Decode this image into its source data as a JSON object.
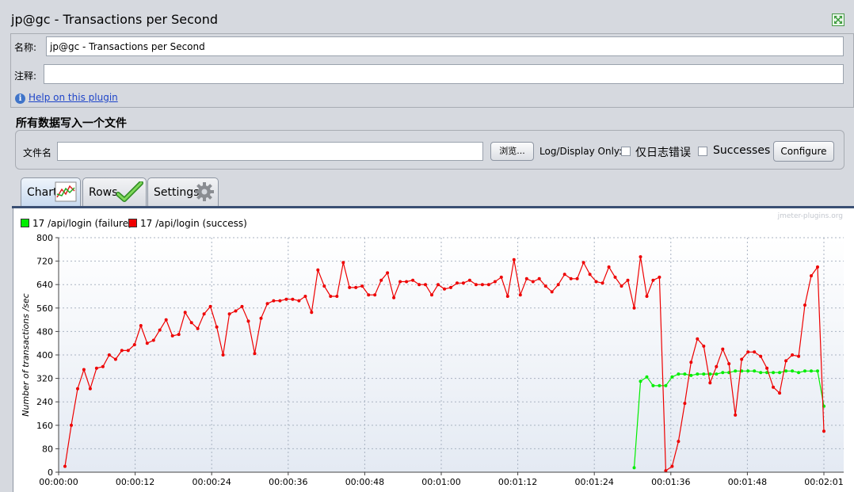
{
  "window": {
    "title": "jp@gc - Transactions per Second"
  },
  "form": {
    "name_label": "名称:",
    "name_value": "jp@gc - Transactions per Second",
    "comment_label": "注释:",
    "comment_value": "",
    "help_link": "Help on this plugin"
  },
  "file_section": {
    "title": "所有数据写入一个文件",
    "filename_label": "文件名",
    "filename_value": "",
    "browse_label": "浏览...",
    "log_display_label": "Log/Display Only:",
    "errors_only_label": "仅日志错误",
    "errors_only_checked": false,
    "successes_label": "Successes",
    "successes_checked": false,
    "configure_label": "Configure"
  },
  "tabs": [
    {
      "label": "Chart",
      "icon": "chart-icon",
      "active": true
    },
    {
      "label": "Rows",
      "icon": "checkmark-icon",
      "active": false
    },
    {
      "label": "Settings",
      "icon": "gear-icon",
      "active": false
    }
  ],
  "watermark": "jmeter-plugins.org",
  "colors": {
    "failure": "#00ee00",
    "success": "#ee0000",
    "tab_rule": "#3a4f73",
    "link": "#1f45c9"
  },
  "chart_data": {
    "type": "line",
    "ylabel": "Number of transactions /sec",
    "xlabel": "",
    "ylim": [
      0,
      800
    ],
    "yticks": [
      0,
      80,
      160,
      240,
      320,
      400,
      480,
      560,
      640,
      720,
      800
    ],
    "xticks": [
      "00:00:00",
      "00:00:12",
      "00:00:24",
      "00:00:36",
      "00:00:48",
      "00:01:00",
      "00:01:12",
      "00:01:24",
      "00:01:36",
      "00:01:48",
      "00:02:01"
    ],
    "x_range_seconds": [
      0,
      121
    ],
    "grid": true,
    "legend_position": "top-left",
    "series": [
      {
        "name": "17 /api/login (failure)",
        "color": "#00ee00",
        "x_start": 91,
        "values": [
          15,
          310,
          325,
          295,
          295,
          295,
          325,
          335,
          335,
          330,
          335,
          335,
          335,
          335,
          340,
          340,
          345,
          345,
          345,
          345,
          340,
          340,
          340,
          340,
          345,
          345,
          340,
          345,
          345,
          345,
          225
        ]
      },
      {
        "name": "17 /api/login (success)",
        "color": "#ee0000",
        "x_start": 1,
        "values": [
          20,
          160,
          285,
          350,
          285,
          355,
          360,
          400,
          385,
          415,
          415,
          435,
          500,
          440,
          450,
          485,
          520,
          465,
          470,
          545,
          510,
          490,
          540,
          565,
          495,
          400,
          540,
          550,
          565,
          515,
          405,
          525,
          575,
          585,
          585,
          590,
          590,
          585,
          600,
          545,
          690,
          635,
          600,
          600,
          715,
          630,
          630,
          635,
          605,
          605,
          655,
          680,
          595,
          650,
          650,
          655,
          640,
          640,
          605,
          640,
          625,
          630,
          645,
          645,
          655,
          640,
          640,
          640,
          650,
          665,
          600,
          725,
          605,
          660,
          650,
          660,
          635,
          615,
          640,
          675,
          660,
          660,
          715,
          675,
          650,
          645,
          700,
          665,
          635,
          655,
          560,
          735,
          600,
          655,
          665,
          5,
          20,
          105,
          235,
          375,
          455,
          430,
          305,
          360,
          420,
          370,
          195,
          385,
          410,
          410,
          395,
          355,
          290,
          270,
          380,
          400,
          395,
          570,
          670,
          700,
          140
        ]
      }
    ]
  }
}
